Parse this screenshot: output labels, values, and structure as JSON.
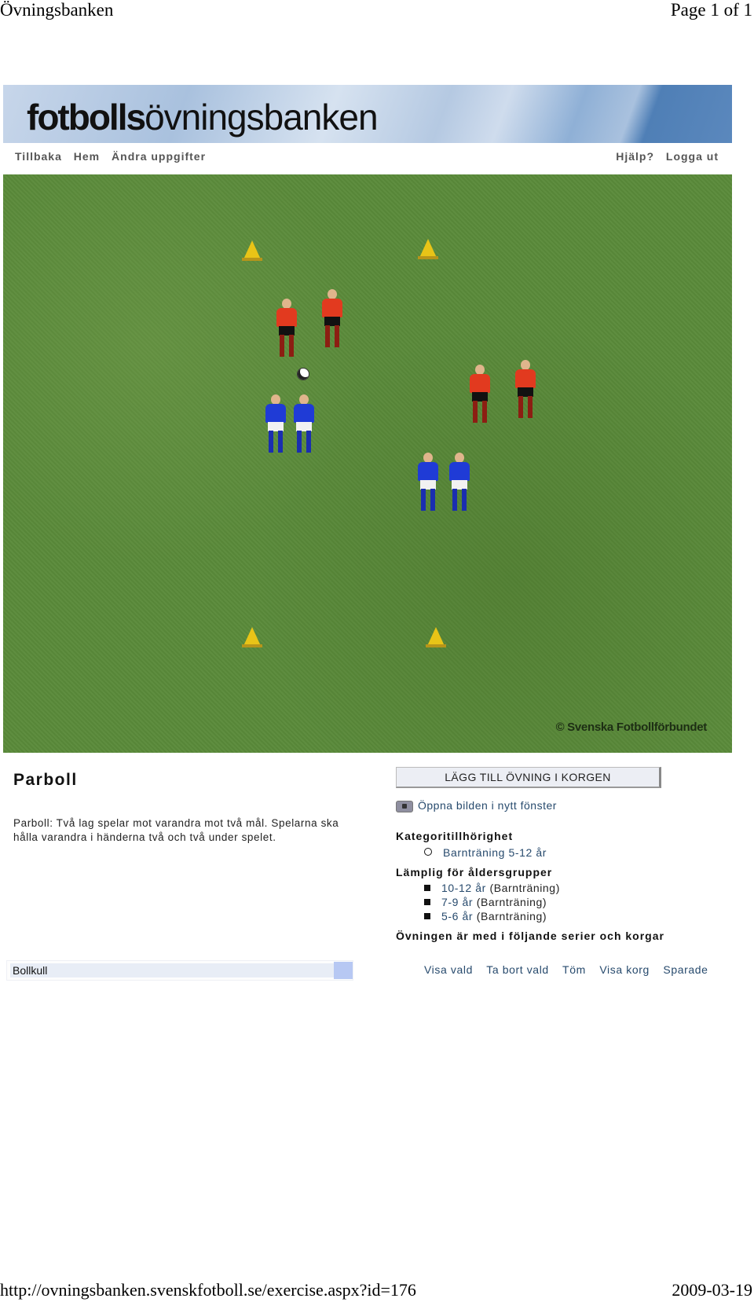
{
  "print_header": {
    "title": "Övningsbanken",
    "page": "Page 1 of 1"
  },
  "banner": {
    "logo_bold": "fotbolls",
    "logo_light": "övningsbanken"
  },
  "nav": {
    "left": [
      "Tillbaka",
      "Hem",
      "Ändra uppgifter"
    ],
    "right": [
      "Hjälp?",
      "Logga ut"
    ]
  },
  "diagram": {
    "copyright": "© Svenska Fotbollförbundet",
    "cones": 4,
    "red_players": 4,
    "blue_players": 4,
    "balls": 1
  },
  "exercise": {
    "title": "Parboll",
    "description": "Parboll: Två lag spelar mot varandra mot två mål. Spelarna ska hålla varandra i händerna två och två under spelet."
  },
  "sidebar": {
    "add_button": "LÄGG TILL ÖVNING I KORGEN",
    "open_image": "Öppna bilden i nytt fönster",
    "category_heading": "Kategoritillhörighet",
    "categories": [
      "Barnträning 5-12 år"
    ],
    "age_heading": "Lämplig för åldersgrupper",
    "age_groups": [
      {
        "age": "10-12 år",
        "type": "(Barnträning)"
      },
      {
        "age": "7-9 år",
        "type": "(Barnträning)"
      },
      {
        "age": "5-6 år",
        "type": "(Barnträning)"
      }
    ],
    "series_heading": "Övningen är med i följande serier och korgar"
  },
  "basket": {
    "selected": "Bollkull",
    "actions": [
      "Visa vald",
      "Ta bort vald",
      "Töm",
      "Visa korg",
      "Sparade"
    ]
  },
  "print_footer": {
    "url": "http://ovningsbanken.svenskfotboll.se/exercise.aspx?id=176",
    "date": "2009-03-19"
  }
}
